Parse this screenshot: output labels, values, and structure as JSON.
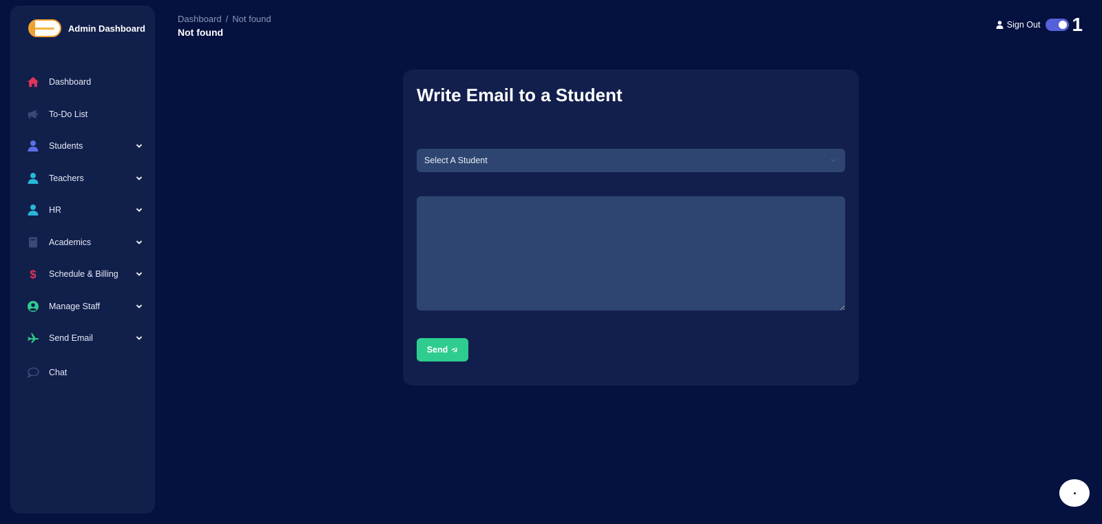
{
  "brand": {
    "name": "Admin Dashboard"
  },
  "sidebar": {
    "items": [
      {
        "label": "Dashboard",
        "icon": "home-icon",
        "color": "#e0345a",
        "expandable": false
      },
      {
        "label": "To-Do List",
        "icon": "megaphone-icon",
        "color": "#3a4a78",
        "expandable": false
      },
      {
        "label": "Students",
        "icon": "user-icon",
        "color": "#5b6ee8",
        "expandable": true
      },
      {
        "label": "Teachers",
        "icon": "user-icon",
        "color": "#28b7d8",
        "expandable": true
      },
      {
        "label": "HR",
        "icon": "user-icon",
        "color": "#28b7d8",
        "expandable": true
      },
      {
        "label": "Academics",
        "icon": "book-icon",
        "color": "#3a4a78",
        "expandable": true
      },
      {
        "label": "Schedule & Billing",
        "icon": "dollar-icon",
        "color": "#e0345a",
        "expandable": true
      },
      {
        "label": "Manage Staff",
        "icon": "user-circle-icon",
        "color": "#2ecc8e",
        "expandable": true
      },
      {
        "label": "Send Email",
        "icon": "plane-icon",
        "color": "#2ecc8e",
        "expandable": true
      },
      {
        "label": "Chat",
        "icon": "chat-icon",
        "color": "#3a4a78",
        "expandable": false
      }
    ]
  },
  "header": {
    "breadcrumb": {
      "root": "Dashboard",
      "separator": "/",
      "current": "Not found"
    },
    "title": "Not found",
    "signout_label": "Sign Out",
    "badge_number": "1"
  },
  "card": {
    "title": "Write Email to a Student",
    "select_placeholder": "Select A Student",
    "message_value": "",
    "send_label": "Send"
  },
  "colors": {
    "background": "#05113f",
    "panel": "#121f4d",
    "input": "#2d4570",
    "accent_green": "#2ecc8e",
    "toggle": "#5561d8"
  }
}
